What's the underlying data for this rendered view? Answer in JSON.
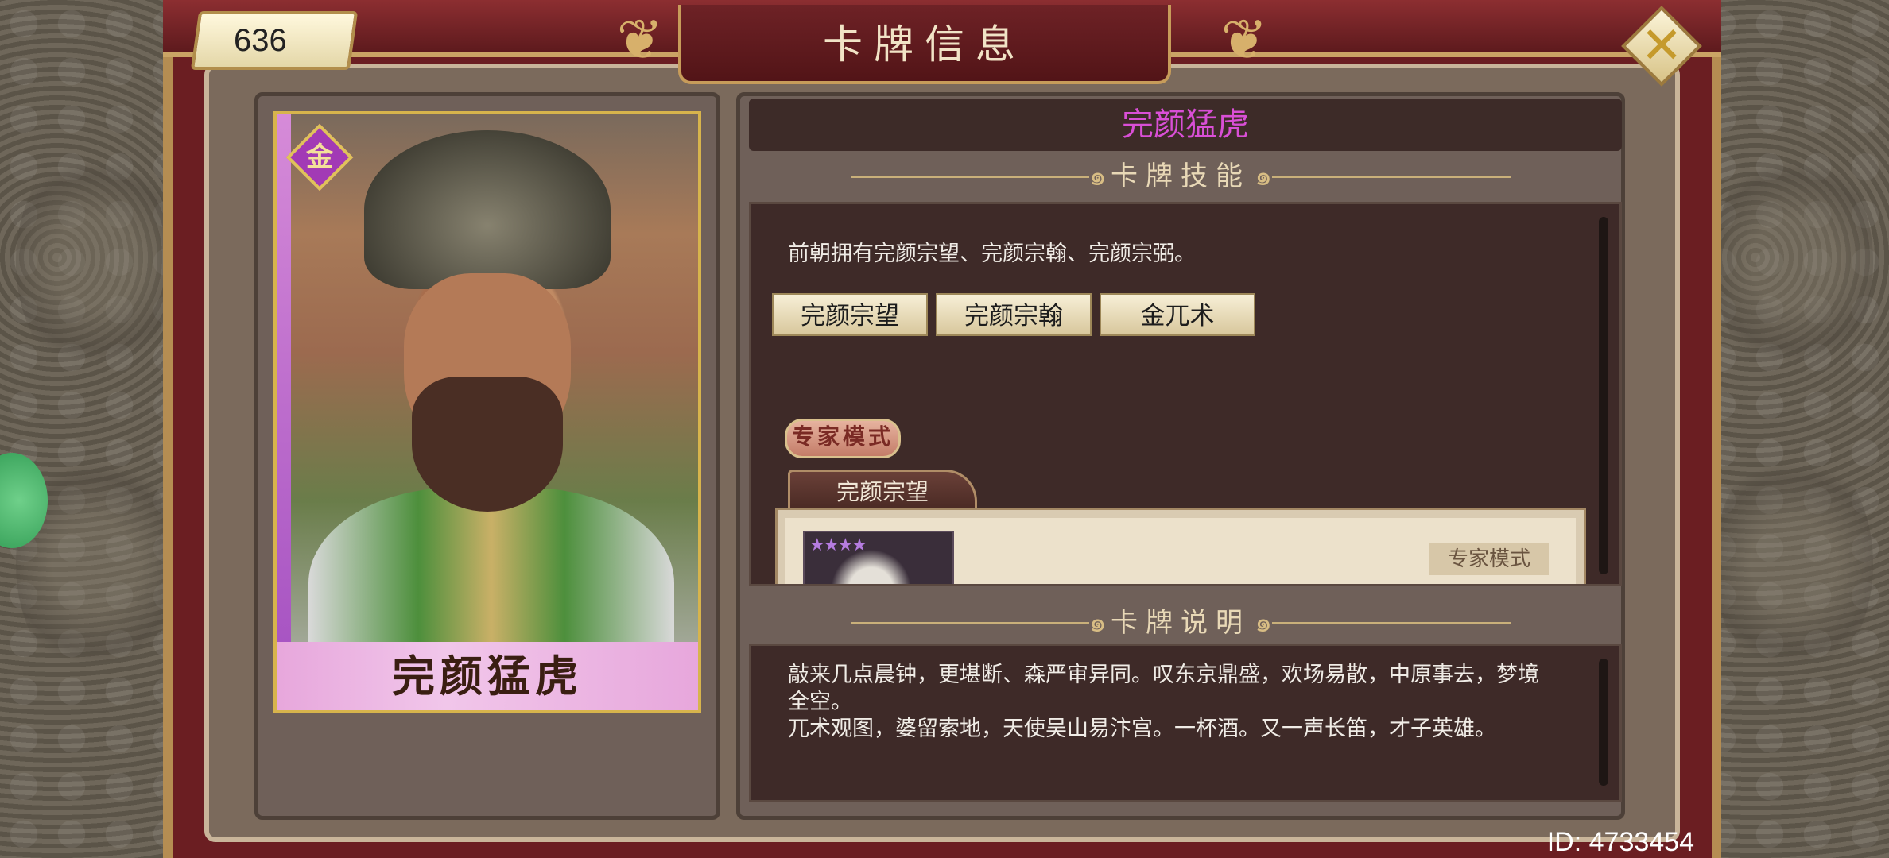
{
  "header": {
    "title": "卡牌信息",
    "score": "636",
    "close_icon": "close-x-icon"
  },
  "card": {
    "name": "完颜猛虎",
    "faction_char": "金",
    "rarity_color": "#a23ab5"
  },
  "detail": {
    "name": "完颜猛虎",
    "name_color": "#d94fd6",
    "skill_heading": "卡牌技能",
    "skill_text": "前朝拥有完颜宗望、完颜宗翰、完颜宗弼。",
    "related_cards": [
      "完颜宗望",
      "完颜宗翰",
      "金兀术"
    ],
    "expert_tag": "专家模式",
    "active_tab": "完颜宗望",
    "stars": "★★★★",
    "expert_label": "专家模式",
    "desc_heading": "卡牌说明",
    "desc_line1": "敲来几点晨钟，更堪断、森严审异同。叹东京鼎盛，欢场易散，中原事去，梦境全空。",
    "desc_line2": "兀术观图，婆留索地，天使吴山易汴宫。一杯酒。又一声长笛，才子英雄。"
  },
  "footer": {
    "id": "ID: 4733454"
  }
}
